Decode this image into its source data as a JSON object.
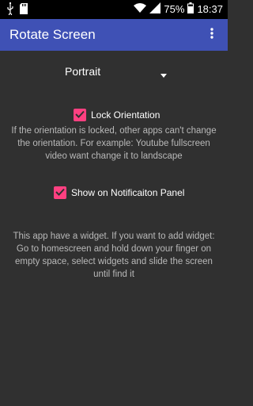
{
  "status_bar": {
    "battery": "75%",
    "time": "18:37",
    "icons": [
      "usb-icon",
      "sd-card-icon",
      "wifi-icon",
      "signal-icon",
      "battery-icon"
    ]
  },
  "app_bar": {
    "title": "Rotate Screen",
    "menu_icon": "more-vert-icon"
  },
  "orientation_spinner": {
    "selected": "Portrait"
  },
  "lock_orientation": {
    "label": "Lock Orientation",
    "checked": true,
    "description": "If the orientation is locked, other apps can't change the orientation. For example: Youtube fullscreen video want change it to landscape"
  },
  "notification_panel": {
    "label": "Show on Notificaiton Panel",
    "checked": true
  },
  "widget_info": "This app have a widget. If you want to add widget: Go to homescreen and hold down your finger on empty space, select widgets and slide the screen until find it",
  "colors": {
    "app_bar": "#3f51b5",
    "background": "#303030",
    "accent": "#ff4081"
  }
}
